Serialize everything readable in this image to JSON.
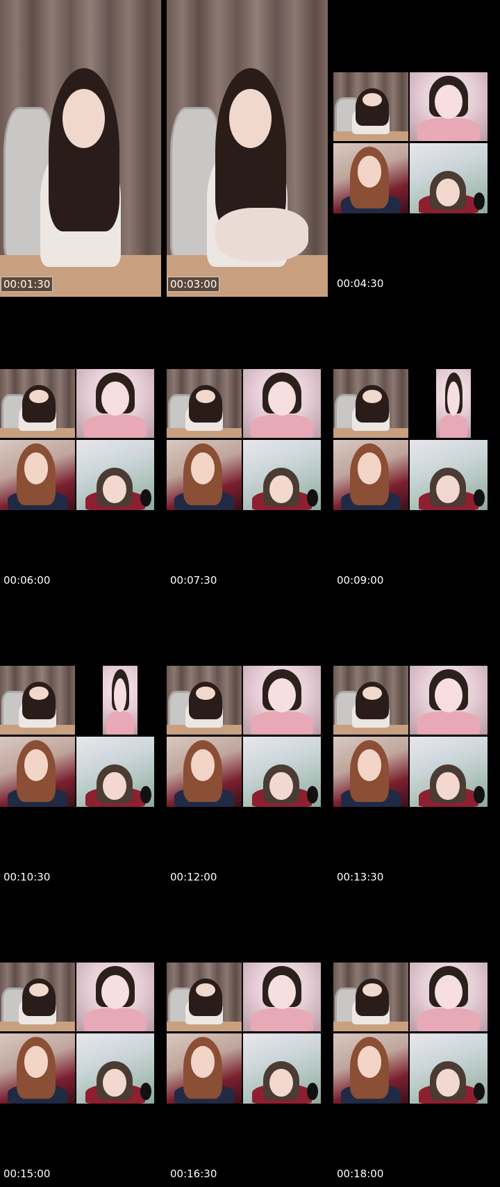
{
  "frames": [
    {
      "id": "f1",
      "timestamp": "00:01:30",
      "boxed": true,
      "layout": "single",
      "scene": "curtain"
    },
    {
      "id": "f2",
      "timestamp": "00:03:00",
      "boxed": true,
      "layout": "single",
      "scene": "curtain"
    },
    {
      "id": "f3",
      "timestamp": "00:04:30",
      "boxed": false,
      "layout": "grid4"
    },
    {
      "id": "f4",
      "timestamp": "00:06:00",
      "boxed": false,
      "layout": "grid4"
    },
    {
      "id": "f5",
      "timestamp": "00:07:30",
      "boxed": false,
      "layout": "grid4"
    },
    {
      "id": "f6",
      "timestamp": "00:09:00",
      "boxed": false,
      "layout": "grid4-small-top-right"
    },
    {
      "id": "f7",
      "timestamp": "00:10:30",
      "boxed": false,
      "layout": "grid4-small-top-right"
    },
    {
      "id": "f8",
      "timestamp": "00:12:00",
      "boxed": false,
      "layout": "grid4"
    },
    {
      "id": "f9",
      "timestamp": "00:13:30",
      "boxed": false,
      "layout": "grid4"
    },
    {
      "id": "f10",
      "timestamp": "00:15:00",
      "boxed": false,
      "layout": "grid4"
    },
    {
      "id": "f11",
      "timestamp": "00:16:30",
      "boxed": false,
      "layout": "grid4"
    },
    {
      "id": "f12",
      "timestamp": "00:18:00",
      "boxed": false,
      "layout": "grid4"
    }
  ],
  "colors": {
    "background": "#000000",
    "timestamp_text": "#ffffff"
  }
}
